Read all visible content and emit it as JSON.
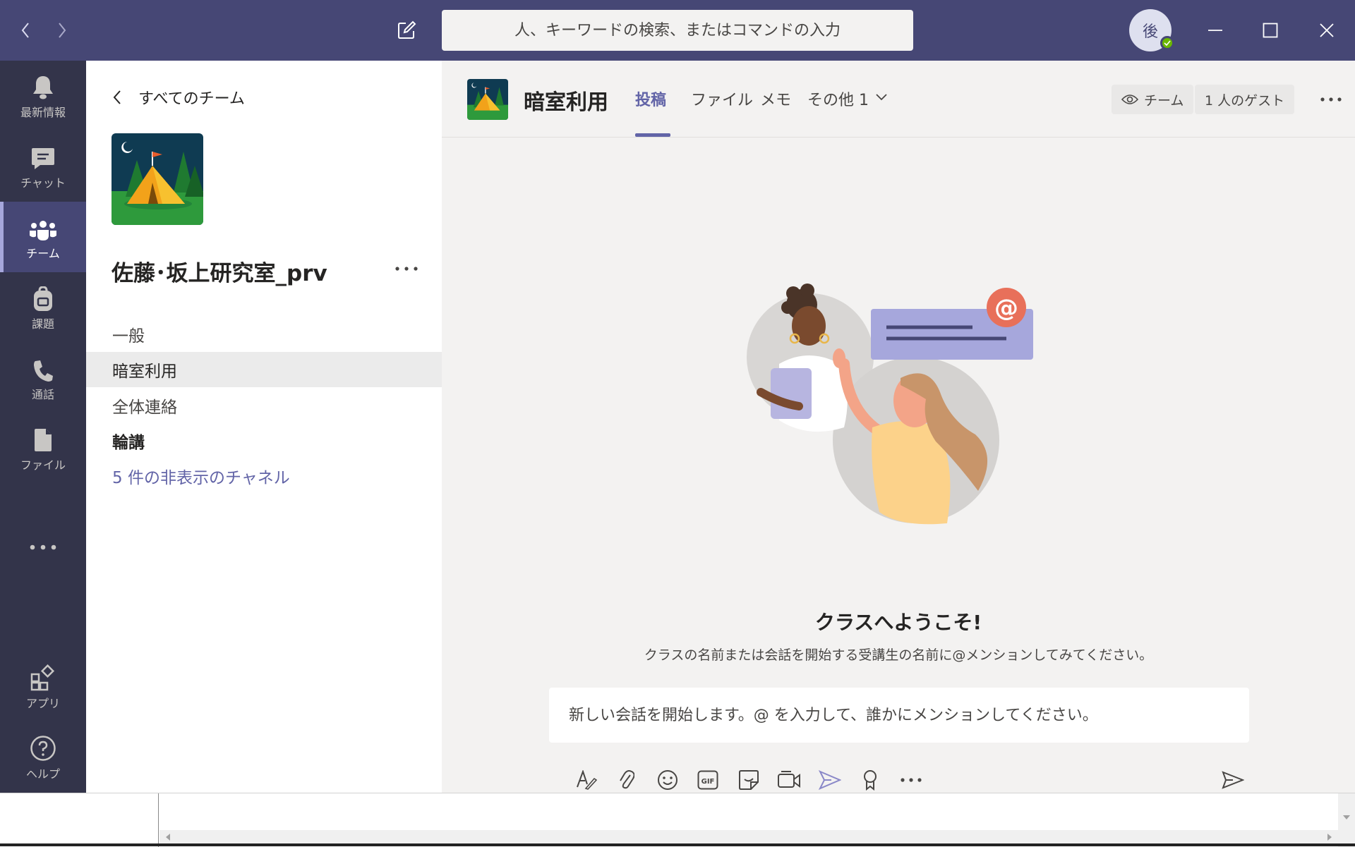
{
  "titlebar": {
    "search_placeholder": "人、キーワードの検索、またはコマンドの入力",
    "avatar_initial": "後"
  },
  "rail": {
    "items": [
      {
        "label": "最新情報",
        "icon": "bell-icon"
      },
      {
        "label": "チャット",
        "icon": "chat-icon"
      },
      {
        "label": "チーム",
        "icon": "teams-icon",
        "active": true
      },
      {
        "label": "課題",
        "icon": "backpack-icon"
      },
      {
        "label": "通話",
        "icon": "phone-icon"
      },
      {
        "label": "ファイル",
        "icon": "file-icon"
      },
      {
        "label": "アプリ",
        "icon": "apps-icon"
      },
      {
        "label": "ヘルプ",
        "icon": "help-icon"
      }
    ]
  },
  "panel": {
    "back_label": "すべてのチーム",
    "team_name": "佐藤･坂上研究室_prv",
    "channels": [
      {
        "label": "一般"
      },
      {
        "label": "暗室利用",
        "selected": true
      },
      {
        "label": "全体連絡"
      },
      {
        "label": "輪講",
        "bold": true
      },
      {
        "label": "5 件の非表示のチャネル",
        "link": true
      }
    ]
  },
  "main": {
    "channel_title": "暗室利用",
    "tabs": [
      {
        "label": "投稿",
        "active": true
      },
      {
        "label": "ファイル"
      },
      {
        "label": "メモ"
      },
      {
        "label": "その他 1"
      }
    ],
    "team_pill": "チーム",
    "guest_pill": "1 人のゲスト",
    "welcome_title": "クラスへようこそ!",
    "welcome_sub": "クラスの名前または会話を開始する受講生の名前に@メンションしてみてください。",
    "compose_placeholder": "新しい会話を開始します。@ を入力して、誰かにメンションしてください。"
  },
  "colors": {
    "titlebar": "#464775",
    "rail": "#33344a",
    "accent": "#6264a7",
    "main_bg": "#f3f2f1"
  }
}
